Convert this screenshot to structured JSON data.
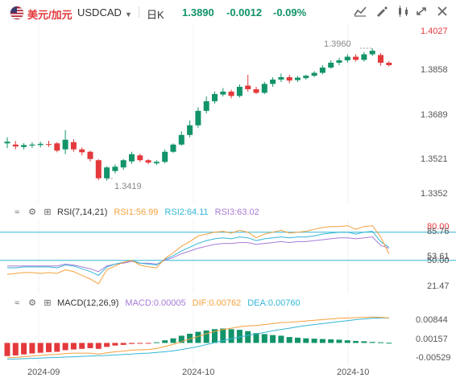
{
  "toolbar": {
    "pair_cn": "美元/加元",
    "pair_code": "USDCAD",
    "period": "日K",
    "last_price": "1.3890",
    "change": "-0.0012",
    "change_pct": "-0.09%",
    "icons": [
      "flag-icon",
      "chevron-down-icon",
      "indicator-icon",
      "draw-icon",
      "compare-icon",
      "fullscreen-icon",
      "close-icon"
    ]
  },
  "main": {
    "y_labels": [
      "1.4027",
      "1.3858",
      "1.3689",
      "1.3521",
      "1.3352"
    ],
    "high_label": "1.3960",
    "low_label": "1.3419"
  },
  "rsi": {
    "title": "RSI(7,14,21)",
    "rsi1": "RSI1:56.99",
    "rsi2": "RSI2:64.11",
    "rsi3": "RSI3:63.02",
    "y_labels": [
      "80.00",
      "85.76",
      "53.61",
      "50.00",
      "21.47"
    ],
    "colors": {
      "rsi1": "#f5a03c",
      "rsi2": "#33b6d6",
      "rsi3": "#a77bd6"
    }
  },
  "macd": {
    "title": "MACD(12,26,9)",
    "macd": "MACD:0.00005",
    "dif": "DIF:0.00762",
    "dea": "DEA:0.00760",
    "y_labels": [
      "0.00844",
      "0.00157",
      "-0.00529"
    ],
    "colors": {
      "macd": "#a77bd6",
      "dif": "#f5a03c",
      "dea": "#33b6d6"
    }
  },
  "x_labels": [
    "2024-09",
    "2024-10",
    "2024-10"
  ],
  "colors": {
    "up": "#12936a",
    "down": "#e4393c"
  },
  "chart_data": {
    "type": "candlestick",
    "y_range": [
      1.3352,
      1.4027
    ],
    "high": 1.396,
    "low": 1.3419,
    "candles": [
      [
        1.3565,
        1.3572,
        1.3545,
        1.359
      ],
      [
        1.356,
        1.3552,
        1.354,
        1.3575
      ],
      [
        1.355,
        1.3558,
        1.354,
        1.3566
      ],
      [
        1.3556,
        1.356,
        1.3546,
        1.357
      ],
      [
        1.3558,
        1.3563,
        1.3548,
        1.3572
      ],
      [
        1.3562,
        1.356,
        1.355,
        1.3576
      ],
      [
        1.3565,
        1.3535,
        1.3528,
        1.357
      ],
      [
        1.354,
        1.358,
        1.352,
        1.362
      ],
      [
        1.357,
        1.354,
        1.353,
        1.3582
      ],
      [
        1.354,
        1.3528,
        1.3515,
        1.3548
      ],
      [
        1.353,
        1.35,
        1.349,
        1.3535
      ],
      [
        1.3495,
        1.342,
        1.3412,
        1.35
      ],
      [
        1.342,
        1.3465,
        1.341,
        1.347
      ],
      [
        1.345,
        1.3468,
        1.344,
        1.3478
      ],
      [
        1.3465,
        1.3495,
        1.3455,
        1.35
      ],
      [
        1.349,
        1.352,
        1.348,
        1.353
      ],
      [
        1.3515,
        1.3495,
        1.3488,
        1.3522
      ],
      [
        1.3495,
        1.3485,
        1.3478,
        1.35
      ],
      [
        1.3482,
        1.3488,
        1.3475,
        1.3495
      ],
      [
        1.3488,
        1.353,
        1.3482,
        1.354
      ],
      [
        1.353,
        1.356,
        1.3525,
        1.3565
      ],
      [
        1.356,
        1.36,
        1.3555,
        1.3615
      ],
      [
        1.36,
        1.364,
        1.359,
        1.366
      ],
      [
        1.364,
        1.37,
        1.363,
        1.3715
      ],
      [
        1.37,
        1.374,
        1.369,
        1.376
      ],
      [
        1.374,
        1.377,
        1.373,
        1.378
      ],
      [
        1.3768,
        1.378,
        1.376,
        1.3795
      ],
      [
        1.378,
        1.3762,
        1.3752,
        1.3788
      ],
      [
        1.3762,
        1.38,
        1.3755,
        1.381
      ],
      [
        1.3805,
        1.379,
        1.378,
        1.385
      ],
      [
        1.379,
        1.3775,
        1.377,
        1.38
      ],
      [
        1.3775,
        1.3812,
        1.377,
        1.382
      ],
      [
        1.3812,
        1.383,
        1.38,
        1.384
      ],
      [
        1.383,
        1.384,
        1.382,
        1.3855
      ],
      [
        1.384,
        1.3826,
        1.3815,
        1.385
      ],
      [
        1.3828,
        1.3838,
        1.382,
        1.3845
      ],
      [
        1.3836,
        1.3846,
        1.383,
        1.385
      ],
      [
        1.3846,
        1.3858,
        1.384,
        1.3865
      ],
      [
        1.3858,
        1.388,
        1.3852,
        1.389
      ],
      [
        1.388,
        1.39,
        1.3875,
        1.391
      ],
      [
        1.39,
        1.391,
        1.389,
        1.392
      ],
      [
        1.391,
        1.3925,
        1.39,
        1.3935
      ],
      [
        1.3925,
        1.3912,
        1.3905,
        1.3935
      ],
      [
        1.3912,
        1.3935,
        1.3905,
        1.3945
      ],
      [
        1.3935,
        1.395,
        1.3928,
        1.396
      ],
      [
        1.3932,
        1.39,
        1.3888,
        1.394
      ],
      [
        1.39,
        1.389,
        1.3884,
        1.3906
      ]
    ],
    "rsi_range": [
      21.47,
      85.76
    ],
    "rsi1": [
      35,
      36,
      37,
      37,
      36,
      37,
      36,
      40,
      38,
      34,
      30,
      25,
      40,
      44,
      48,
      50,
      45,
      43,
      42,
      52,
      58,
      65,
      70,
      76,
      78,
      80,
      81,
      79,
      82,
      80,
      74,
      78,
      80,
      82,
      79,
      80,
      81,
      83,
      85,
      86,
      86,
      87,
      83,
      86,
      87,
      75,
      57
    ],
    "rsi2": [
      42,
      42,
      43,
      43,
      43,
      43,
      42,
      45,
      44,
      41,
      38,
      34,
      43,
      46,
      48,
      50,
      47,
      46,
      45,
      51,
      55,
      60,
      64,
      68,
      71,
      73,
      74,
      73,
      75,
      74,
      71,
      73,
      74,
      75,
      74,
      75,
      75,
      76,
      78,
      79,
      80,
      80,
      78,
      80,
      81,
      70,
      64
    ],
    "rsi3": [
      44,
      44,
      44,
      44,
      44,
      44,
      44,
      46,
      45,
      43,
      41,
      38,
      44,
      46,
      47,
      49,
      47,
      47,
      46,
      50,
      53,
      57,
      60,
      63,
      65,
      67,
      68,
      68,
      69,
      69,
      67,
      68,
      69,
      70,
      69,
      70,
      70,
      71,
      72,
      73,
      74,
      74,
      73,
      74,
      75,
      66,
      63
    ],
    "macd_range": [
      -0.00529,
      0.00844
    ],
    "macd_hist": [
      -0.004,
      -0.0038,
      -0.0035,
      -0.0032,
      -0.003,
      -0.0028,
      -0.0027,
      -0.0022,
      -0.002,
      -0.0018,
      -0.0016,
      -0.0018,
      -0.0012,
      -0.0008,
      -0.0006,
      -0.0003,
      -0.0002,
      -0.0001,
      0.0002,
      0.0008,
      0.0014,
      0.0022,
      0.0028,
      0.0034,
      0.0038,
      0.0042,
      0.0044,
      0.0042,
      0.004,
      0.0036,
      0.003,
      0.0027,
      0.0024,
      0.0022,
      0.0018,
      0.0016,
      0.0014,
      0.0013,
      0.0012,
      0.0011,
      0.001,
      0.0008,
      0.0006,
      0.0005,
      0.0003,
      0.0002,
      5e-05
    ],
    "dif": [
      -0.0045,
      -0.0044,
      -0.0042,
      -0.004,
      -0.0038,
      -0.0036,
      -0.0035,
      -0.0032,
      -0.0031,
      -0.0031,
      -0.0031,
      -0.0034,
      -0.003,
      -0.0027,
      -0.0025,
      -0.0022,
      -0.0021,
      -0.002,
      -0.0017,
      -0.0011,
      -0.0004,
      0.0004,
      0.0012,
      0.002,
      0.0028,
      0.0035,
      0.0041,
      0.0045,
      0.0049,
      0.0052,
      0.0053,
      0.0056,
      0.0059,
      0.0062,
      0.0063,
      0.0065,
      0.0067,
      0.0069,
      0.0071,
      0.0073,
      0.0075,
      0.0076,
      0.0077,
      0.0078,
      0.0079,
      0.0078,
      0.00762
    ],
    "dea": [
      -0.005,
      -0.0049,
      -0.0048,
      -0.0047,
      -0.0046,
      -0.0045,
      -0.0044,
      -0.0043,
      -0.0042,
      -0.0041,
      -0.004,
      -0.0039,
      -0.0038,
      -0.0037,
      -0.0035,
      -0.0034,
      -0.0032,
      -0.0031,
      -0.0029,
      -0.0027,
      -0.0024,
      -0.002,
      -0.0016,
      -0.0011,
      -0.0005,
      0.0001,
      0.0007,
      0.0013,
      0.0018,
      0.0023,
      0.0028,
      0.0032,
      0.0037,
      0.0041,
      0.0045,
      0.0049,
      0.0053,
      0.0056,
      0.0059,
      0.0062,
      0.0065,
      0.0068,
      0.0071,
      0.0073,
      0.0075,
      0.0076,
      0.0076
    ]
  }
}
